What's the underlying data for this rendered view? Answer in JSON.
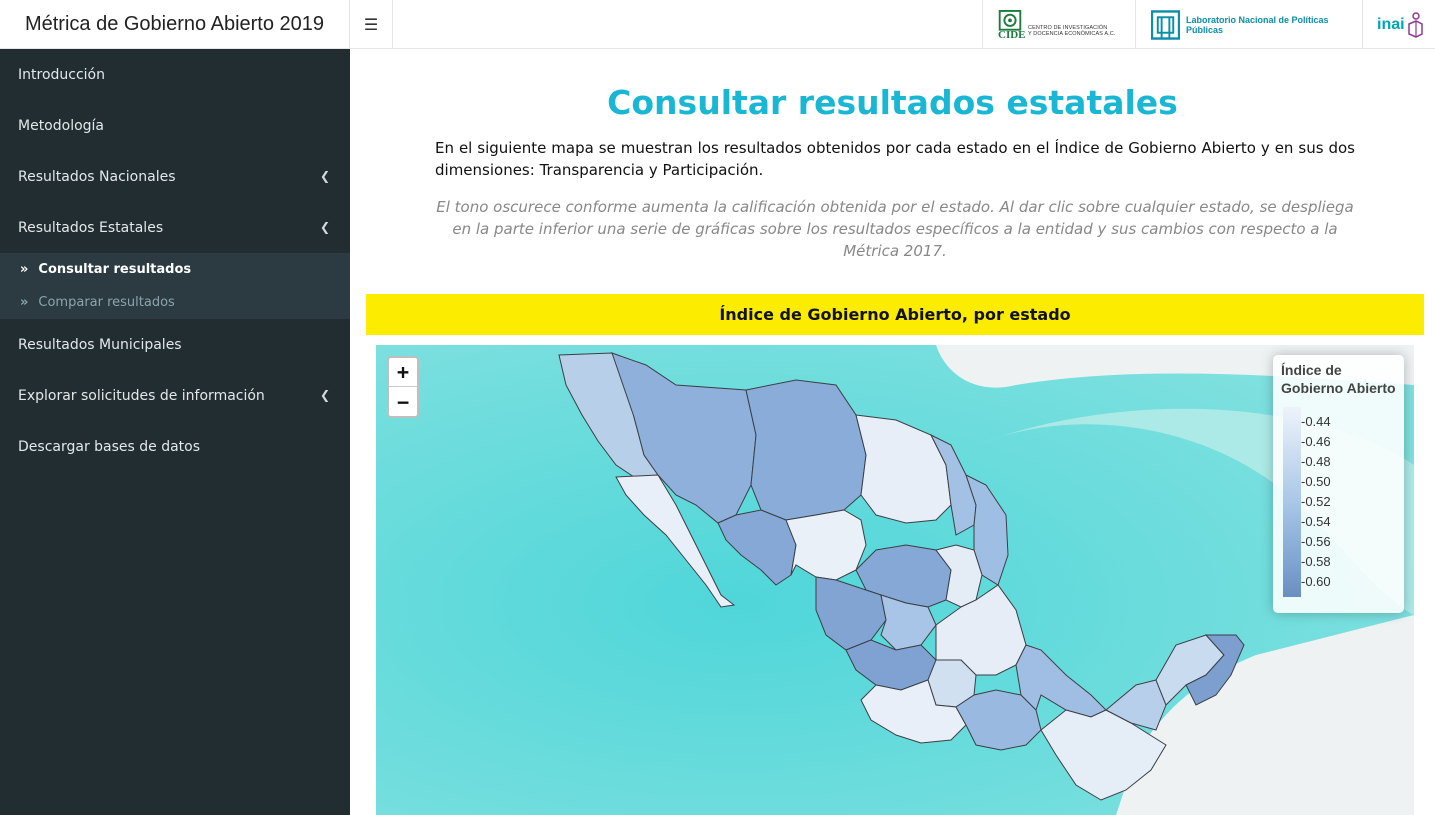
{
  "header": {
    "app_title": "Métrica de Gobierno Abierto 2019",
    "menu_icon": "bars-icon",
    "logos": {
      "cide_name": "CIDE",
      "cide_line1": "CENTRO DE INVESTIGACIÓN",
      "cide_line2": "Y DOCENCIA ECONÓMICAS A.C.",
      "lnpp_name": "Laboratorio Nacional de Políticas Públicas",
      "inai_name": "inai"
    }
  },
  "sidebar": {
    "items": [
      {
        "label": "Introducción"
      },
      {
        "label": "Metodología"
      },
      {
        "label": "Resultados Nacionales",
        "icon": "chevron-left-icon"
      },
      {
        "label": "Resultados Estatales",
        "icon": "chevron-left-icon"
      },
      {
        "label": "Resultados Municipales"
      },
      {
        "label": "Explorar solicitudes de información",
        "icon": "chevron-left-icon"
      },
      {
        "label": "Descargar bases de datos"
      }
    ],
    "submenu": [
      {
        "label": "Consultar resultados",
        "icon": "double-chevron-right-icon",
        "active": true
      },
      {
        "label": "Comparar resultados",
        "icon": "double-chevron-right-icon",
        "active": false
      }
    ]
  },
  "main": {
    "title": "Consultar resultados estatales",
    "intro": "En el siguiente mapa se muestran los resultados obtenidos por cada estado en el Índice de Gobierno Abierto y en sus dos dimensiones: Transparencia y Participación.",
    "note": "El tono oscurece conforme aumenta la calificación obtenida por el estado. Al dar clic sobre cualquier estado, se despliega en la parte inferior una serie de gráficas sobre los resultados específicos a la entidad y sus cambios con respecto a la Métrica 2017.",
    "banner": "Índice de Gobierno Abierto, por estado"
  },
  "map": {
    "zoom_in": "+",
    "zoom_out": "−",
    "legend": {
      "title": "Índice de Gobierno Abierto",
      "ticks": [
        "0.44",
        "0.46",
        "0.48",
        "0.50",
        "0.52",
        "0.54",
        "0.56",
        "0.58",
        "0.60"
      ]
    },
    "colors": {
      "ocean": "#5fd9dc",
      "land": "#f4f6f7",
      "low": "#eef3fa",
      "high": "#6a8fbf"
    }
  }
}
